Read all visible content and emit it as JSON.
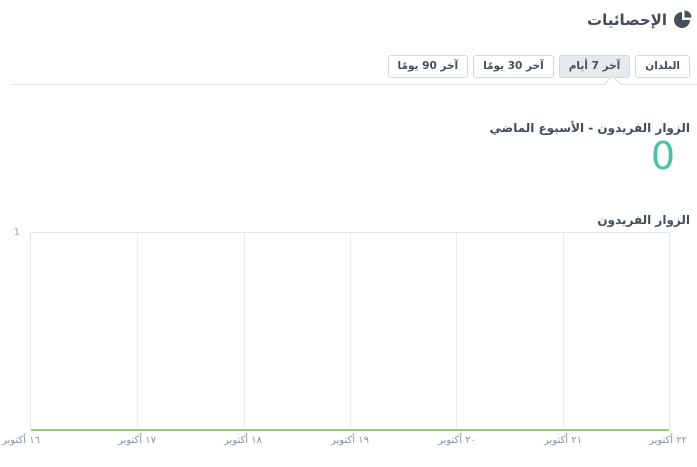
{
  "header": {
    "title": "الإحصائيات",
    "icon": "pie-chart-icon",
    "icon_color": "#474f5c"
  },
  "filters": {
    "buttons": [
      {
        "id": "countries",
        "label": "البلدان",
        "selected": false
      },
      {
        "id": "last-7-days",
        "label": "آخر 7 أيام",
        "selected": true
      },
      {
        "id": "last-30-days",
        "label": "آخر 30 يومًا",
        "selected": false
      },
      {
        "id": "last-90-days",
        "label": "آخر 90 يومًا",
        "selected": false
      }
    ]
  },
  "stat": {
    "label": "الزوار الفريدون - الأسبوع الماضي",
    "value": "0",
    "value_color": "#4cbfa4"
  },
  "chart": {
    "title": "الزوار الفريدون",
    "y_axis_top_tick": "1"
  },
  "chart_data": {
    "type": "line",
    "title": "الزوار الفريدون",
    "categories": [
      "١٦ أكتوبر",
      "١٧ أكتوبر",
      "١٨ أكتوبر",
      "١٩ أكتوبر",
      "٢٠ أكتوبر",
      "٢١ أكتوبر",
      "٢٢ أكتوبر"
    ],
    "series": [
      {
        "name": "الزوار الفريدون",
        "values": [
          0,
          0,
          0,
          0,
          0,
          0,
          0
        ],
        "color": "#9ccc65"
      }
    ],
    "ylim": [
      0,
      1
    ],
    "y_ticks": [
      1
    ],
    "grid": "vertical",
    "legend": "none",
    "line_color": "#9ccc65",
    "grid_color": "#ececec"
  }
}
